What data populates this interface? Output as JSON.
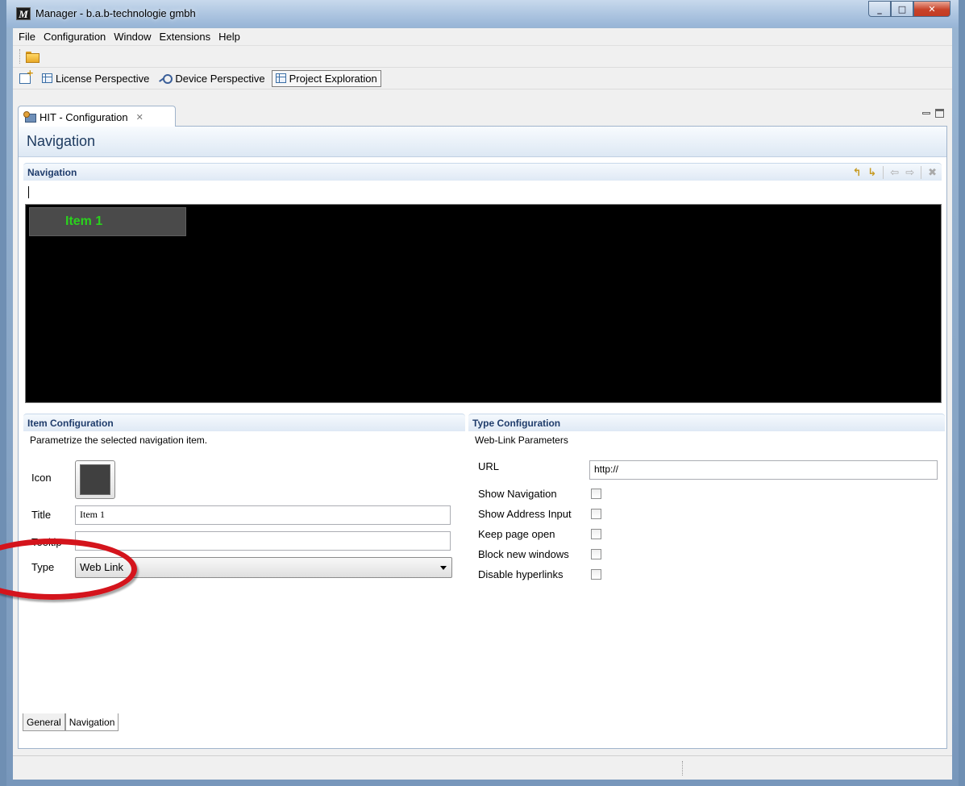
{
  "window": {
    "title": "Manager - b.a.b-technologie gmbh",
    "app_icon_letter": "M"
  },
  "menu": [
    "File",
    "Configuration",
    "Window",
    "Extensions",
    "Help"
  ],
  "perspectives": [
    {
      "label": "License Perspective",
      "icon": "grid-icon"
    },
    {
      "label": "Device Perspective",
      "icon": "device-icon"
    },
    {
      "label": "Project Exploration",
      "icon": "grid-icon",
      "active": true
    }
  ],
  "editor_tab": {
    "label": "HIT - Configuration",
    "close": "✕"
  },
  "form": {
    "title": "Navigation"
  },
  "navigation_section": {
    "title": "Navigation",
    "items": [
      "Item 1"
    ],
    "item_color": "#2ad21d"
  },
  "item_configuration": {
    "title": "Item Configuration",
    "description": "Parametrize the selected navigation item.",
    "icon_label": "Icon",
    "title_label": "Title",
    "title_value": "Item 1",
    "tooltip_label": "Tooltip",
    "tooltip_value": "",
    "type_label": "Type",
    "type_value": "Web Link"
  },
  "type_configuration": {
    "title": "Type Configuration",
    "subtitle": "Web-Link Parameters",
    "url_label": "URL",
    "url_value": "http://",
    "options": [
      {
        "label": "Show Navigation",
        "checked": false
      },
      {
        "label": "Show Address Input",
        "checked": false
      },
      {
        "label": "Keep page open",
        "checked": false
      },
      {
        "label": "Block new windows",
        "checked": false
      },
      {
        "label": "Disable hyperlinks",
        "checked": false
      }
    ]
  },
  "bottom_tabs": [
    {
      "label": "General",
      "active": false
    },
    {
      "label": "Navigation",
      "active": true
    }
  ],
  "colors": {
    "annotation": "#d4141c",
    "header_text": "#1e3b60",
    "section_text": "#1f3c6b"
  }
}
